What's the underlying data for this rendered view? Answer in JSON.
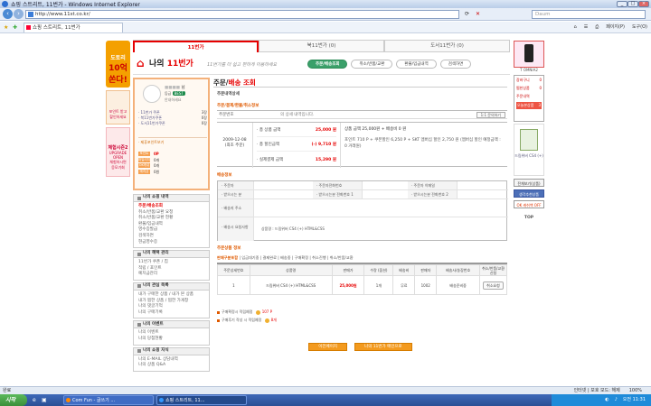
{
  "window": {
    "title": "쇼핑 스트리트, 11번가 - Windows Internet Explorer"
  },
  "address": {
    "url": "http://www.11st.co.kr/",
    "search_placeholder": "Daum"
  },
  "tab": {
    "label": "쇼핑 스트리트, 11번가"
  },
  "toolbar": {
    "page": "페이지(P)",
    "tools": "도구(O)"
  },
  "top_tabs": [
    {
      "label": "11번가"
    },
    {
      "label": "북11번가 (0)"
    },
    {
      "label": "도서11번가 (0)"
    }
  ],
  "my11": {
    "title_a": "나의",
    "title_b": "11번가",
    "slogan": "11번가를 더 쉽고 편하게 이용하세요",
    "tabs": [
      "주문/배송조회",
      "취소/반품/교환",
      "환불/입금내역",
      "검색하면"
    ]
  },
  "profile": {
    "name": "님",
    "level_label": "등급",
    "level": "BEST",
    "link": "안내하세요",
    "stats": [
      {
        "k": "· 11번가 쿠폰",
        "v": "3장"
      },
      {
        "k": "· 북11번가쿠폰",
        "v": "0장"
      },
      {
        "k": "· 도서11번가쿠폰",
        "v": "0장"
      }
    ],
    "coupon_note": "· 제휴포인트보기",
    "points": [
      {
        "tag": "포인트",
        "v": "0P"
      },
      {
        "tag": "마일리지",
        "v": "0개"
      },
      {
        "tag": "OK캐쉬백",
        "v": "0개"
      },
      {
        "tag": "예치금",
        "v": "0원"
      }
    ]
  },
  "side_menu": [
    {
      "title": "나의 쇼핑 내역",
      "items": [
        "주문/배송조회",
        "취소/반품/교환 요청",
        "취소/반품/교환 현황",
        "환불/입금내역",
        "영수증발급",
        "검색하면",
        "현금영수증"
      ]
    },
    {
      "title": "나의 혜택 관리",
      "items": [
        "11번가 쿠폰 / 칩",
        "적립 / 포인트",
        "예치금관리"
      ]
    },
    {
      "title": "나의 관심 목록",
      "items": [
        "내가 구매한 상품 / 내가 본 상품",
        "내가 찜한 상품 / 찜한 가게창",
        "나의 댓글기억",
        "나의 구매기록"
      ]
    },
    {
      "title": "나의 이벤트",
      "items": [
        "나의 이벤트",
        "나의 당첨현황"
      ]
    },
    {
      "title": "나의 쇼핑 지식",
      "items": [
        "나의 E-MAIL 상담내역",
        "나의 상품 Q&A"
      ]
    }
  ],
  "content": {
    "title_a": "주문/",
    "title_b": "배송 조회",
    "sub": "주문내역상세",
    "sec1": "주문/결제/환불/취소정보",
    "order_no_label": "주문번호",
    "order_no_value": "의 상세 내역입니다.",
    "order_no_btn": "1:1 문의하기",
    "pay_date": "2009-12-08",
    "pay_date2": "(최초 주문)",
    "pay_rows": [
      {
        "k": "· 총 상품 금액",
        "v": "25,000 원"
      },
      {
        "k": "· 총 할인금액",
        "v": "(-) 9,710 원"
      },
      {
        "k": "· 실제결제 금액",
        "v": "15,290 원"
      }
    ],
    "pay_info1": "상품 금액 25,000원 + 배송비 0 원",
    "pay_info2": "포인트 710 P + 쿠폰할인 6,250 P + SKT 멤버십 할인 2,750 원 (멤버십 할인 예정금액 : 0 거래원)",
    "sec2": "배송정보",
    "deliv": [
      {
        "k": "· 주문자",
        "v": ""
      },
      {
        "k": "· 주문자전화번호",
        "v": ""
      },
      {
        "k": "· 주문자 이메일",
        "v": ""
      },
      {
        "k": "· 받으시는 분",
        "v": ""
      },
      {
        "k": "· 받으시는분 전화번호 1",
        "v": ""
      },
      {
        "k": "· 받으시는분 전화번호 2",
        "v": ""
      },
      {
        "k": "· 배송지 주소",
        "v": ""
      },
      {
        "k": "· 배송시 요청사항",
        "v": "상품명 : 드림위버 CS4 (+) HTML&CSS"
      }
    ],
    "sec3": "주문상품 정보",
    "sec3_note_a": "판매구분포함",
    "sec3_note_b": "| 입금대기중 | 결제완료 | 배송중 | 구매확정 | 취소진행 | 취소/반품/교환",
    "table_headers": [
      "주문상세번호",
      "상품명",
      "판매가",
      "수량 (옵션)",
      "배송비",
      "판매자",
      "배송사/송장번호",
      "취소/반품/교환 신청"
    ],
    "table_rows": [
      {
        "no": "1",
        "name": "드림위버 CS4 (+) HTML&CSS",
        "price": "25,000원",
        "qty": "1개",
        "ship": "무료",
        "seller": "1002",
        "courier": "배송준비중",
        "action": "취소요청"
      }
    ],
    "notes": [
      {
        "k": "구매확정시 적립예정",
        "v": "107 P"
      },
      {
        "k": "구매후기 작성 시 적립예정",
        "v": "8개"
      }
    ],
    "btn1": "이전페이지",
    "btn2": "나의 11번가 메인으로"
  },
  "left_ad": {
    "t1": "도토리",
    "t2": "10억",
    "t3": "쏜다!",
    "t4": "포인트 받고",
    "t5": "할인하세요",
    "t6": "체험시즌2",
    "t7": "UPGRADE OPEN",
    "t8": "체험하시면",
    "t9": "응모기회"
  },
  "right_ad": {
    "phone": "T OMNIA2",
    "tools": [
      {
        "k": "장바구니",
        "v": "0"
      },
      {
        "k": "찜한상품",
        "v": "0"
      },
      {
        "k": "주문내역",
        "v": ""
      },
      {
        "k": "오늘본상품",
        "v": "3"
      }
    ],
    "mini": "드림위버 CS4 (+)",
    "btn1": "전체보기(상품)",
    "btn2": "생각추천상품",
    "btn3": "OK 캐쉬백 OFF",
    "top": "TOP"
  },
  "status": {
    "left": "완료",
    "zone": "인터넷 | 보호 모드: 해제",
    "zoom": "100%"
  },
  "taskbar": {
    "start": "시작",
    "task1": "Com Fun - 글쓰기 ...",
    "task2": "쇼핑 스트리트, 11...",
    "clock": "오전 11:31"
  }
}
